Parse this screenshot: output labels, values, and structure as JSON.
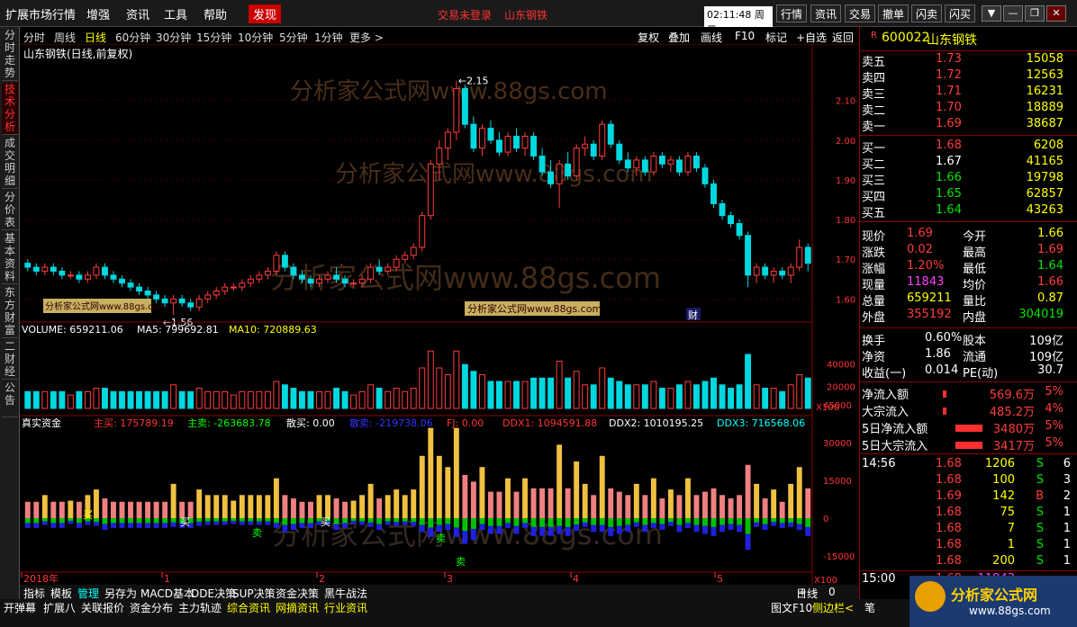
{
  "menubar": {
    "items": [
      "扩展市场行情",
      "增强",
      "资讯",
      "工具",
      "帮助"
    ],
    "discover": "发现",
    "login_status": "交易未登录",
    "stock_link": "山东钢铁",
    "clock": "02:11:48",
    "weekday": "周二",
    "quick_buttons": [
      "行情",
      "资讯",
      "交易",
      "撤单",
      "闪卖",
      "闪买"
    ]
  },
  "sidebar": {
    "tabs": [
      "分时走势",
      "技术分析",
      "成交明细",
      "分价表",
      "基本资料",
      "东方财富",
      "二财经",
      "公告"
    ]
  },
  "periods": [
    "分时",
    "周线",
    "日线",
    "60分钟",
    "30分钟",
    "15分钟",
    "10分钟",
    "5分钟",
    "1分钟",
    "更多 >"
  ],
  "active_period": "日线",
  "tools": [
    "复权",
    "叠加",
    "画线",
    "F10",
    "标记",
    "+自选",
    "返回"
  ],
  "chart_data": {
    "type": "candlestick",
    "title": "山东钢铁(日线,前复权)",
    "watermark": "分析家公式网www.88gs.com",
    "watermark_box": "分析家公式网www.88gs.com",
    "price_ticks": [
      2.1,
      2.0,
      1.9,
      1.8,
      1.7,
      1.6
    ],
    "ylim": [
      1.56,
      2.19
    ],
    "high_label": "2.15",
    "low_label": "1.56",
    "cai_label": "财",
    "ohlc": [
      [
        1.69,
        1.7,
        1.67,
        1.68
      ],
      [
        1.68,
        1.69,
        1.66,
        1.67
      ],
      [
        1.67,
        1.69,
        1.66,
        1.68
      ],
      [
        1.68,
        1.69,
        1.66,
        1.67
      ],
      [
        1.67,
        1.68,
        1.65,
        1.66
      ],
      [
        1.66,
        1.67,
        1.65,
        1.66
      ],
      [
        1.66,
        1.67,
        1.64,
        1.65
      ],
      [
        1.65,
        1.67,
        1.64,
        1.66
      ],
      [
        1.66,
        1.69,
        1.65,
        1.68
      ],
      [
        1.68,
        1.69,
        1.65,
        1.66
      ],
      [
        1.66,
        1.67,
        1.64,
        1.65
      ],
      [
        1.65,
        1.66,
        1.63,
        1.64
      ],
      [
        1.64,
        1.65,
        1.62,
        1.63
      ],
      [
        1.63,
        1.64,
        1.61,
        1.62
      ],
      [
        1.62,
        1.63,
        1.6,
        1.61
      ],
      [
        1.61,
        1.62,
        1.59,
        1.6
      ],
      [
        1.6,
        1.61,
        1.58,
        1.59
      ],
      [
        1.59,
        1.61,
        1.56,
        1.6
      ],
      [
        1.6,
        1.61,
        1.58,
        1.59
      ],
      [
        1.59,
        1.6,
        1.57,
        1.58
      ],
      [
        1.58,
        1.61,
        1.57,
        1.6
      ],
      [
        1.6,
        1.62,
        1.59,
        1.61
      ],
      [
        1.61,
        1.63,
        1.6,
        1.62
      ],
      [
        1.62,
        1.64,
        1.61,
        1.63
      ],
      [
        1.63,
        1.64,
        1.62,
        1.63
      ],
      [
        1.63,
        1.65,
        1.62,
        1.64
      ],
      [
        1.64,
        1.66,
        1.63,
        1.65
      ],
      [
        1.65,
        1.67,
        1.64,
        1.66
      ],
      [
        1.66,
        1.68,
        1.65,
        1.67
      ],
      [
        1.67,
        1.72,
        1.66,
        1.71
      ],
      [
        1.71,
        1.72,
        1.67,
        1.68
      ],
      [
        1.68,
        1.69,
        1.65,
        1.66
      ],
      [
        1.66,
        1.67,
        1.64,
        1.65
      ],
      [
        1.65,
        1.66,
        1.63,
        1.64
      ],
      [
        1.64,
        1.66,
        1.63,
        1.65
      ],
      [
        1.65,
        1.67,
        1.64,
        1.66
      ],
      [
        1.66,
        1.68,
        1.64,
        1.65
      ],
      [
        1.65,
        1.66,
        1.63,
        1.64
      ],
      [
        1.64,
        1.65,
        1.63,
        1.64
      ],
      [
        1.64,
        1.66,
        1.63,
        1.65
      ],
      [
        1.65,
        1.69,
        1.64,
        1.68
      ],
      [
        1.68,
        1.7,
        1.66,
        1.67
      ],
      [
        1.67,
        1.69,
        1.66,
        1.68
      ],
      [
        1.68,
        1.71,
        1.67,
        1.7
      ],
      [
        1.7,
        1.72,
        1.69,
        1.71
      ],
      [
        1.71,
        1.74,
        1.7,
        1.73
      ],
      [
        1.73,
        1.82,
        1.72,
        1.81
      ],
      [
        1.81,
        1.95,
        1.8,
        1.94
      ],
      [
        1.94,
        2.0,
        1.9,
        1.98
      ],
      [
        1.98,
        2.03,
        1.95,
        2.02
      ],
      [
        2.02,
        2.15,
        2.0,
        2.13
      ],
      [
        2.13,
        2.14,
        2.03,
        2.04
      ],
      [
        2.04,
        2.06,
        1.97,
        1.98
      ],
      [
        1.98,
        2.04,
        1.96,
        2.03
      ],
      [
        2.03,
        2.05,
        1.99,
        2.0
      ],
      [
        2.0,
        2.02,
        1.96,
        1.97
      ],
      [
        1.97,
        2.02,
        1.96,
        2.01
      ],
      [
        2.01,
        2.03,
        1.97,
        1.98
      ],
      [
        1.98,
        2.02,
        1.96,
        2.01
      ],
      [
        2.01,
        2.02,
        1.95,
        1.96
      ],
      [
        1.96,
        1.98,
        1.91,
        1.92
      ],
      [
        1.92,
        1.95,
        1.88,
        1.89
      ],
      [
        1.89,
        1.95,
        1.83,
        1.94
      ],
      [
        1.94,
        1.97,
        1.9,
        1.91
      ],
      [
        1.91,
        1.99,
        1.9,
        1.98
      ],
      [
        1.98,
        2.01,
        1.96,
        1.99
      ],
      [
        1.99,
        2.0,
        1.95,
        1.96
      ],
      [
        1.96,
        2.05,
        1.95,
        2.04
      ],
      [
        2.04,
        2.05,
        1.98,
        1.99
      ],
      [
        1.99,
        2.0,
        1.94,
        1.95
      ],
      [
        1.95,
        1.97,
        1.92,
        1.93
      ],
      [
        1.93,
        1.96,
        1.91,
        1.95
      ],
      [
        1.95,
        1.96,
        1.91,
        1.92
      ],
      [
        1.92,
        1.97,
        1.91,
        1.96
      ],
      [
        1.96,
        1.97,
        1.93,
        1.94
      ],
      [
        1.94,
        1.96,
        1.92,
        1.95
      ],
      [
        1.95,
        1.96,
        1.91,
        1.92
      ],
      [
        1.92,
        1.97,
        1.91,
        1.96
      ],
      [
        1.96,
        1.97,
        1.92,
        1.93
      ],
      [
        1.93,
        1.94,
        1.88,
        1.89
      ],
      [
        1.89,
        1.9,
        1.83,
        1.84
      ],
      [
        1.84,
        1.85,
        1.8,
        1.81
      ],
      [
        1.81,
        1.82,
        1.78,
        1.79
      ],
      [
        1.79,
        1.8,
        1.75,
        1.76
      ],
      [
        1.76,
        1.77,
        1.63,
        1.66
      ],
      [
        1.66,
        1.69,
        1.64,
        1.68
      ],
      [
        1.68,
        1.69,
        1.65,
        1.66
      ],
      [
        1.66,
        1.68,
        1.64,
        1.67
      ],
      [
        1.67,
        1.68,
        1.65,
        1.66
      ],
      [
        1.66,
        1.69,
        1.64,
        1.68
      ],
      [
        1.68,
        1.75,
        1.67,
        1.73
      ],
      [
        1.73,
        1.74,
        1.67,
        1.69
      ]
    ],
    "volume": {
      "label": "VOLUME: 659211.06",
      "ma5_label": "MA5: 799692.81",
      "ma10_label": "MA10: 720889.63",
      "ticks": [
        40000,
        20000
      ],
      "unit": "X100"
    },
    "fund": {
      "title": "真实资金",
      "main_buy": "主买: 175789.19",
      "main_sell": "主卖: -263683.78",
      "retail_buy": "散买: 0.00",
      "retail_sell": "散卖: -219738.06",
      "fj": "FJ: 0.00",
      "ddx1": "DDX1: 1094591.88",
      "ddx2": "DDX2: 1010195.25",
      "ddx3": "DDX3: 716568.06",
      "ticks": [
        45000,
        30000,
        15000,
        0,
        -15000
      ],
      "unit": "X100",
      "buy_label": "买",
      "sell_label": "卖"
    },
    "x_labels": [
      "2018年",
      "1",
      "2",
      "3",
      "4",
      "5"
    ]
  },
  "quote": {
    "code": "600022",
    "name": "山东钢铁",
    "flag": "R",
    "sells": [
      {
        "label": "卖五",
        "price": "1.73",
        "vol": "15058"
      },
      {
        "label": "卖四",
        "price": "1.72",
        "vol": "12563"
      },
      {
        "label": "卖三",
        "price": "1.71",
        "vol": "16231"
      },
      {
        "label": "卖二",
        "price": "1.70",
        "vol": "18889"
      },
      {
        "label": "卖一",
        "price": "1.69",
        "vol": "38687"
      }
    ],
    "buys": [
      {
        "label": "买一",
        "price": "1.68",
        "vol": "6208"
      },
      {
        "label": "买二",
        "price": "1.67",
        "vol": "41165"
      },
      {
        "label": "买三",
        "price": "1.66",
        "vol": "19798"
      },
      {
        "label": "买四",
        "price": "1.65",
        "vol": "62857"
      },
      {
        "label": "买五",
        "price": "1.64",
        "vol": "43263"
      }
    ],
    "stats": [
      [
        "现价",
        "1.69",
        "今开",
        "1.66"
      ],
      [
        "涨跌",
        "0.02",
        "最高",
        "1.69"
      ],
      [
        "涨幅",
        "1.20%",
        "最低",
        "1.64"
      ],
      [
        "现量",
        "11843",
        "均价",
        "1.66"
      ],
      [
        "总量",
        "659211",
        "量比",
        "0.87"
      ],
      [
        "外盘",
        "355192",
        "内盘",
        "304019"
      ]
    ],
    "fundamentals": [
      [
        "换手",
        "0.60%",
        "股本",
        "109亿"
      ],
      [
        "净资",
        "1.86",
        "流通",
        "109亿"
      ],
      [
        "收益(一)",
        "0.014",
        "PE(动)",
        "30.7"
      ]
    ],
    "flows": [
      [
        "净流入额",
        "569.6万",
        "5%"
      ],
      [
        "大宗流入",
        "485.2万",
        "4%"
      ],
      [
        "5日净流入额",
        "3480万",
        "5%"
      ],
      [
        "5日大宗流入",
        "3417万",
        "5%"
      ]
    ],
    "ticks": [
      [
        "14:56",
        "1.68",
        "1206",
        "S",
        "6"
      ],
      [
        "",
        "1.68",
        "100",
        "S",
        "3"
      ],
      [
        "",
        "1.69",
        "142",
        "B",
        "2"
      ],
      [
        "",
        "1.68",
        "75",
        "S",
        "1"
      ],
      [
        "",
        "1.68",
        "7",
        "S",
        "1"
      ],
      [
        "",
        "1.68",
        "1",
        "S",
        "1"
      ],
      [
        "",
        "1.68",
        "200",
        "S",
        "1"
      ]
    ],
    "close_time": "15:00",
    "close_price": "1.68",
    "close_vol": "11843"
  },
  "bottom": {
    "row1": [
      "指标",
      "模板",
      "管理",
      "另存为",
      "MACD基本",
      "DDE决策",
      "SUP决策",
      "资金决策",
      "黑牛战法"
    ],
    "row1_active": "管理",
    "period_label": "日线",
    "row2": [
      "开弹幕",
      "扩展八",
      "关联报价",
      "资金分布",
      "主力轨迹",
      "综合资讯",
      "网摘资讯",
      "行业资讯"
    ],
    "right_tools": [
      "图文F10",
      "侧边栏<",
      "笔"
    ],
    "logo_cn": "分析家公式网",
    "logo_url": "www.88gs.com",
    "plus": "+",
    "minus": "-",
    "zero": "0"
  }
}
